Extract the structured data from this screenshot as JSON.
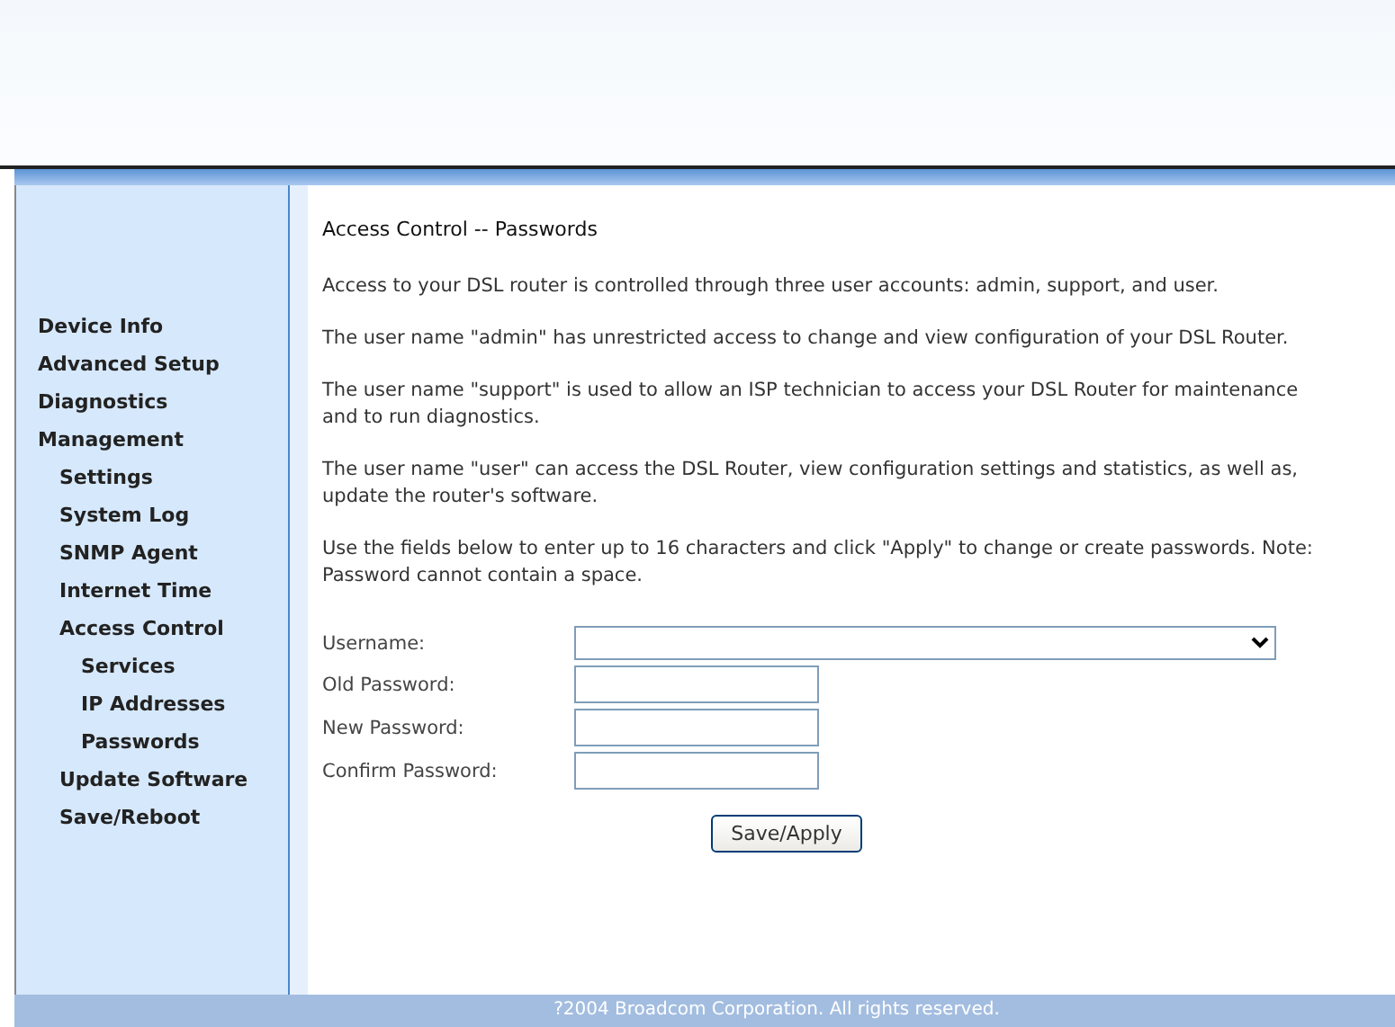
{
  "menu": [
    {
      "label": "Device Info"
    },
    {
      "label": "Advanced Setup"
    },
    {
      "label": "Diagnostics"
    },
    {
      "label": "Management",
      "children": [
        {
          "label": "Settings"
        },
        {
          "label": "System Log"
        },
        {
          "label": "SNMP Agent"
        },
        {
          "label": "Internet Time"
        },
        {
          "label": "Access Control",
          "children": [
            {
              "label": "Services"
            },
            {
              "label": "IP Addresses"
            },
            {
              "label": "Passwords"
            }
          ]
        },
        {
          "label": "Update Software"
        },
        {
          "label": "Save/Reboot"
        }
      ]
    }
  ],
  "content": {
    "title": "Access Control -- Passwords",
    "paragraphs": [
      "Access to your DSL router is controlled through three user accounts: admin, support, and user.",
      "The user name \"admin\" has unrestricted access to change and view configuration of your DSL Router.",
      "The user name \"support\" is used to allow an ISP technician to access your DSL Router for maintenance and to run diagnostics.",
      "The user name \"user\" can access the DSL Router, view configuration settings and statistics, as well as, update the router's software.",
      "Use the fields below to enter up to 16 characters and click \"Apply\" to change or create passwords. Note: Password cannot contain a space."
    ],
    "fields": [
      {
        "label": "Username:",
        "kind": "select"
      },
      {
        "label": "Old Password:",
        "kind": "password"
      },
      {
        "label": "New Password:",
        "kind": "password"
      },
      {
        "label": "Confirm Password:",
        "kind": "password"
      }
    ],
    "button": "Save/Apply"
  },
  "footer": "?2004 Broadcom Corporation. All rights reserved."
}
